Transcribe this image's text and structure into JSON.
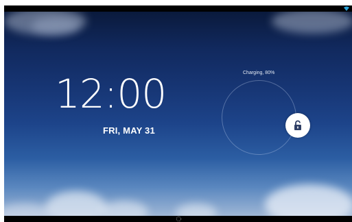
{
  "lockscreen": {
    "time": "12:00",
    "date": "FRI, MAY 31",
    "charging_status": "Charging, 80%"
  },
  "icons": {
    "status_bar": "wifi-icon",
    "unlock": "unlock-icon",
    "nav": "home-icon"
  },
  "colors": {
    "status_icon": "#2aa3d8",
    "text": "#ffffff"
  }
}
